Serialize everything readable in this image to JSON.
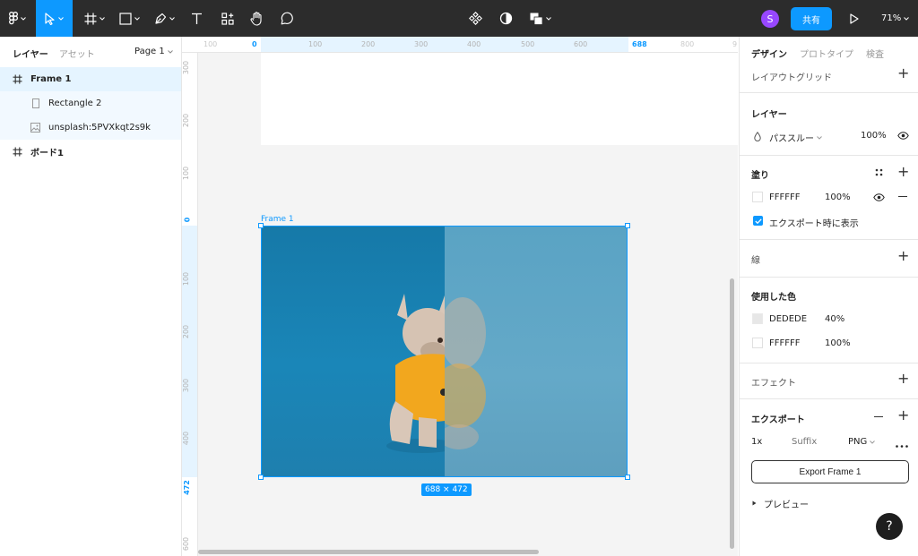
{
  "toolbar": {
    "avatar_initial": "S",
    "share_label": "共有",
    "zoom_label": "71%"
  },
  "left_panel": {
    "tab_layers": "レイヤー",
    "tab_assets": "アセット",
    "page_label": "Page 1",
    "layers": [
      {
        "name": "Frame 1",
        "type": "frame"
      },
      {
        "name": "Rectangle 2",
        "type": "rectangle"
      },
      {
        "name": "unsplash:5PVXkqt2s9k",
        "type": "image"
      },
      {
        "name": "ボード1",
        "type": "frame"
      }
    ]
  },
  "canvas": {
    "ruler_top": [
      "100",
      "0",
      "100",
      "200",
      "300",
      "400",
      "500",
      "600",
      "688",
      "800",
      "9"
    ],
    "ruler_left": [
      "300",
      "200",
      "100",
      "0",
      "100",
      "200",
      "300",
      "400",
      "472",
      "600"
    ],
    "frame_label": "Frame 1",
    "size_badge": "688 × 472"
  },
  "right_panel": {
    "tab_design": "デザイン",
    "tab_prototype": "プロトタイプ",
    "tab_inspect": "検査",
    "layout_grid_title": "レイアウトグリッド",
    "layer_title": "レイヤー",
    "blend_mode": "パススルー",
    "layer_opacity": "100%",
    "fill_title": "塗り",
    "fill_hex": "FFFFFF",
    "fill_opacity": "100%",
    "export_show_label": "エクスポート時に表示",
    "stroke_title": "線",
    "used_colors_title": "使用した色",
    "used_colors": [
      {
        "hex": "DEDEDE",
        "opacity": "40%"
      },
      {
        "hex": "FFFFFF",
        "opacity": "100%"
      }
    ],
    "effects_title": "エフェクト",
    "export_title": "エクスポート",
    "export_scale": "1x",
    "export_suffix_placeholder": "Suffix",
    "export_format": "PNG",
    "export_button": "Export Frame 1",
    "preview_label": "プレビュー",
    "help_label": "?"
  },
  "colors": {
    "accent": "#0d99ff",
    "toolbar_bg": "#2c2c2c",
    "avatar": "#9747ff"
  },
  "icons": [
    "figma-menu-icon",
    "move-tool-icon",
    "frame-tool-icon",
    "shape-tool-icon",
    "pen-tool-icon",
    "text-tool-icon",
    "resources-icon",
    "hand-tool-icon",
    "comment-icon",
    "component-icon",
    "contrast-icon",
    "boolean-icon",
    "play-icon"
  ]
}
